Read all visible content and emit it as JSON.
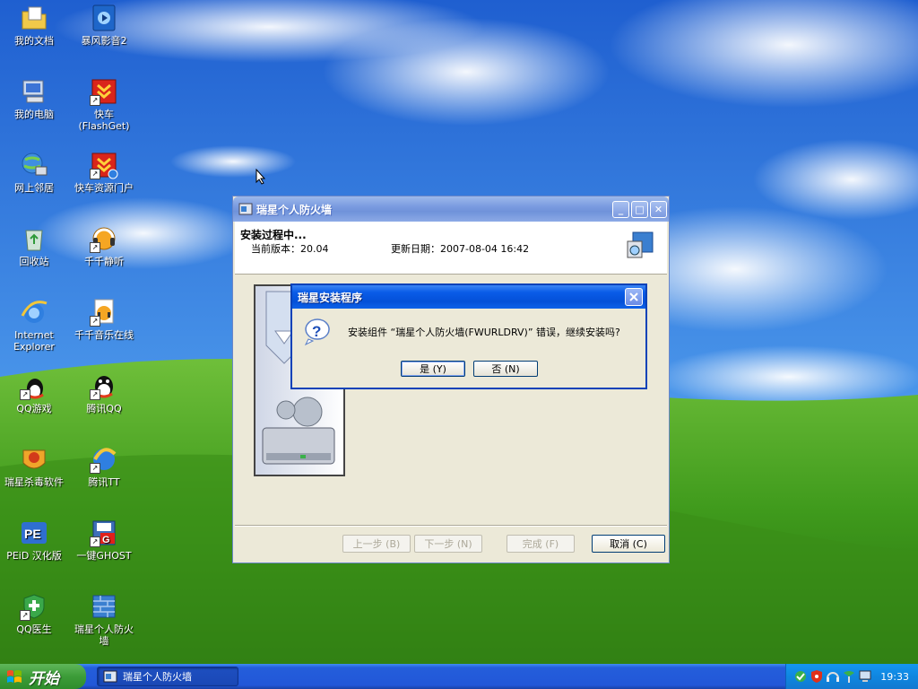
{
  "desktop": {
    "icons": [
      {
        "label": "我的文档",
        "icon": "folder-documents-icon"
      },
      {
        "label": "暴风影音2",
        "icon": "media-player-icon"
      },
      {
        "label": "我的电脑",
        "icon": "computer-icon"
      },
      {
        "label": "快车\n(FlashGet)",
        "icon": "flashget-icon"
      },
      {
        "label": "网上邻居",
        "icon": "network-icon"
      },
      {
        "label": "快车资源门户",
        "icon": "flashget-portal-icon"
      },
      {
        "label": "回收站",
        "icon": "recycle-bin-icon"
      },
      {
        "label": "千千静听",
        "icon": "ttplayer-icon"
      },
      {
        "label": "Internet\nExplorer",
        "icon": "internet-explorer-icon"
      },
      {
        "label": "千千音乐在线",
        "icon": "music-online-icon"
      },
      {
        "label": "QQ游戏",
        "icon": "qq-game-icon"
      },
      {
        "label": "腾讯QQ",
        "icon": "qq-icon"
      },
      {
        "label": "瑞星杀毒软件",
        "icon": "rising-antivirus-icon"
      },
      {
        "label": "腾讯TT",
        "icon": "tencent-tt-icon"
      },
      {
        "label": "PEiD 汉化版",
        "icon": "peid-icon"
      },
      {
        "label": "一键GHOST",
        "icon": "ghost-icon"
      },
      {
        "label": "QQ医生",
        "icon": "qq-doctor-icon"
      },
      {
        "label": "瑞星个人防火\n墙",
        "icon": "rising-firewall-icon"
      }
    ]
  },
  "installer": {
    "title": "瑞星个人防火墙",
    "header": {
      "heading": "安装过程中...",
      "version": "当前版本：20.04",
      "date": "更新日期：2007-08-04 16:42"
    },
    "buttons": {
      "back": "上一步 (B)",
      "next": "下一步 (N)",
      "finish": "完成 (F)",
      "cancel": "取消 (C)"
    }
  },
  "dialog": {
    "title": "瑞星安装程序",
    "message": "安装组件 “瑞星个人防火墙(FWURLDRV)” 错误，继续安装吗?",
    "yes": "是 (Y)",
    "no": "否 (N)"
  },
  "taskbar": {
    "start": "开始",
    "task": "瑞星个人防火墙",
    "clock": "19:33"
  },
  "colors": {
    "titlebar_active": "#0a5ce8",
    "titlebar_inactive": "#7a9be0",
    "window_bg": "#ece9d8",
    "taskbar": "#245edb",
    "start_button": "#3c9c38"
  }
}
